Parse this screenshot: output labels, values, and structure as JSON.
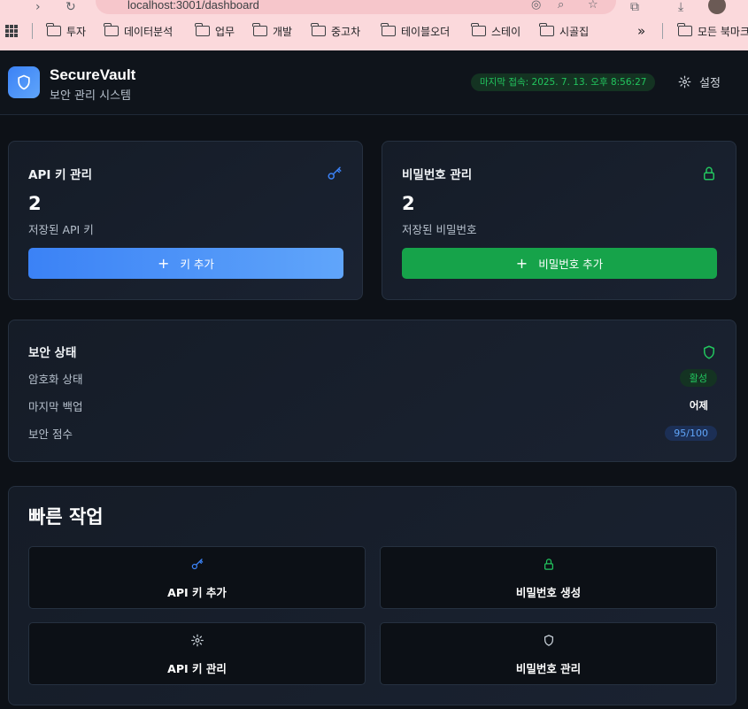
{
  "browser": {
    "url": "localhost:3001/dashboard",
    "bookmarks": [
      "투자",
      "데이터분석",
      "업무",
      "개발",
      "중고차",
      "테이블오더",
      "스테이",
      "시골집"
    ],
    "overflow": "»",
    "other_bookmarks": "모든 북마크"
  },
  "header": {
    "brand": "SecureVault",
    "subtitle": "보안 관리 시스템",
    "last_login": "마지막 접속: 2025. 7. 13. 오후 8:56:27",
    "settings_label": "설정"
  },
  "cards": {
    "api": {
      "title": "API 키 관리",
      "count": "2",
      "sub": "저장된 API 키",
      "button": "키 추가"
    },
    "password": {
      "title": "비밀번호 관리",
      "count": "2",
      "sub": "저장된 비밀번호",
      "button": "비밀번호 추가"
    }
  },
  "security": {
    "title": "보안 상태",
    "encryption_label": "암호화 상태",
    "encryption_value": "활성",
    "backup_label": "마지막 백업",
    "backup_value": "어제",
    "score_label": "보안 점수",
    "score_value": "95/100"
  },
  "quick": {
    "title": "빠른 작업",
    "add_api": "API 키 추가",
    "gen_password": "비밀번호 생성",
    "manage_api": "API 키 관리",
    "manage_password": "비밀번호 관리"
  },
  "colors": {
    "accent_blue": "#3b82f6",
    "accent_green": "#22c55e",
    "background": "#0d1117"
  }
}
